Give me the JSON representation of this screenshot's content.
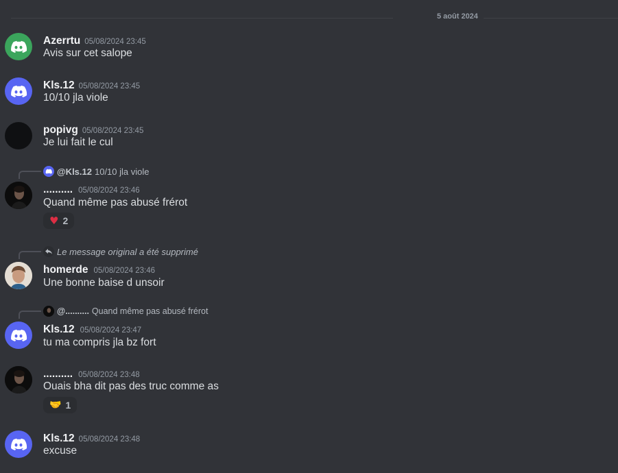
{
  "divider": {
    "date": "5 août 2024"
  },
  "messages": [
    {
      "username": "Azerrtu",
      "timestamp": "05/08/2024 23:45",
      "content": "Avis sur cet salope"
    },
    {
      "username": "Kls.12",
      "timestamp": "05/08/2024 23:45",
      "content": "10/10 jla viole"
    },
    {
      "username": "popivg",
      "timestamp": "05/08/2024 23:45",
      "content": "Je lui fait le cul"
    },
    {
      "reply": {
        "mention": "@Kls.12",
        "text": "10/10 jla viole"
      },
      "username": "..........",
      "timestamp": "05/08/2024 23:46",
      "content": "Quand même pas abusé frérot",
      "reaction": {
        "emoji": "♥",
        "count": "2"
      }
    },
    {
      "reply": {
        "text": "Le message original a été supprimé"
      },
      "username": "homerde",
      "timestamp": "05/08/2024 23:46",
      "content": "Une bonne baise d unsoir"
    },
    {
      "reply": {
        "mention": "@..........",
        "text": "Quand même pas abusé frérot"
      },
      "username": "Kls.12",
      "timestamp": "05/08/2024 23:47",
      "content": "tu ma compris jla bz fort"
    },
    {
      "username": "..........",
      "timestamp": "05/08/2024 23:48",
      "content": "Ouais bha dit pas des truc comme as",
      "reaction": {
        "emoji": "🤝",
        "count": "1"
      }
    },
    {
      "username": "Kls.12",
      "timestamp": "05/08/2024 23:48",
      "content": "excuse"
    }
  ]
}
